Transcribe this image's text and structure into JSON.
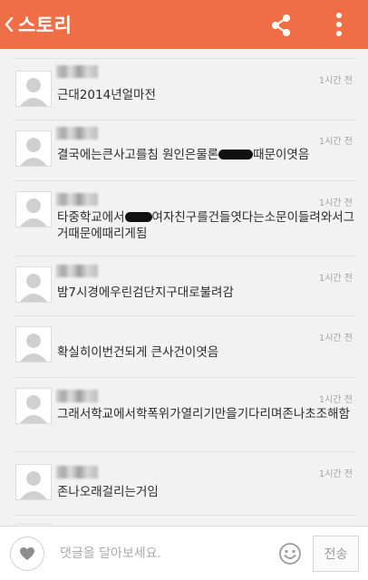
{
  "header": {
    "back_icon": "chevron-left-icon",
    "title": "스토리",
    "share_icon": "share-icon",
    "more_icon": "more-vertical-icon",
    "bg_color": "#f06e45"
  },
  "comments": [
    {
      "time": "1시간 전",
      "segments": [
        "근대2014년얼마전"
      ]
    },
    {
      "time": "1시간 전",
      "segments": [
        "결국에는큰사고를침 원인은물론",
        "",
        "때문이엿음"
      ]
    },
    {
      "time": "1시간 전",
      "segments": [
        "타중학교에서",
        "",
        "여자친구를건들엿다는소문이들려와서그거때문에때리게됨"
      ]
    },
    {
      "time": "1시간 전",
      "segments": [
        "밤7시경에우린검단지구대로불려감"
      ]
    },
    {
      "time": "1시간 전",
      "segments": [
        "확실히이번건되게 큰사건이엿음"
      ]
    },
    {
      "time": "1시간 전",
      "segments": [
        "그래서학교에서학폭위가열리기만을기다리며존나초조해함"
      ]
    },
    {
      "time": "1시간 전",
      "segments": [
        "존나오래걸리는거임"
      ]
    }
  ],
  "comment_bar": {
    "like_icon": "heart-icon",
    "placeholder": "댓글을 달아보세요.",
    "emoji_icon": "smiley-icon",
    "send_label": "전송"
  }
}
